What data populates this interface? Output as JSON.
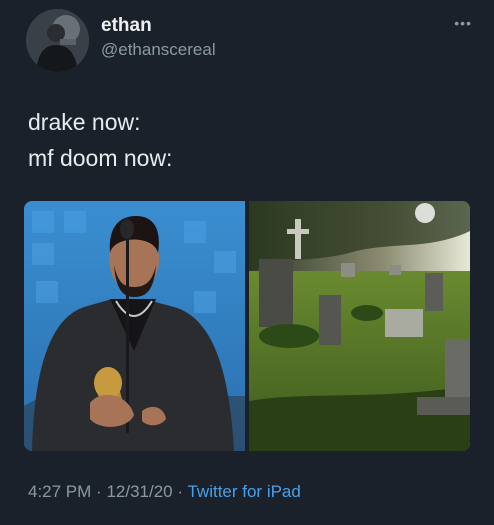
{
  "tweet": {
    "author": {
      "display_name": "ethan",
      "handle": "@ethanscereal"
    },
    "more_icon": "more-dots-icon",
    "text_lines": [
      "drake now:",
      "mf doom now:"
    ],
    "media": [
      {
        "name": "drake-award-photo"
      },
      {
        "name": "cemetery-photo"
      }
    ],
    "meta": {
      "time": "4:27 PM",
      "separator": "·",
      "date": "12/31/20",
      "source": "Twitter for iPad"
    }
  },
  "colors": {
    "background": "#1a212b",
    "text": "#e6e9ec",
    "muted": "#8b98a5",
    "link": "#4aa0e8"
  }
}
